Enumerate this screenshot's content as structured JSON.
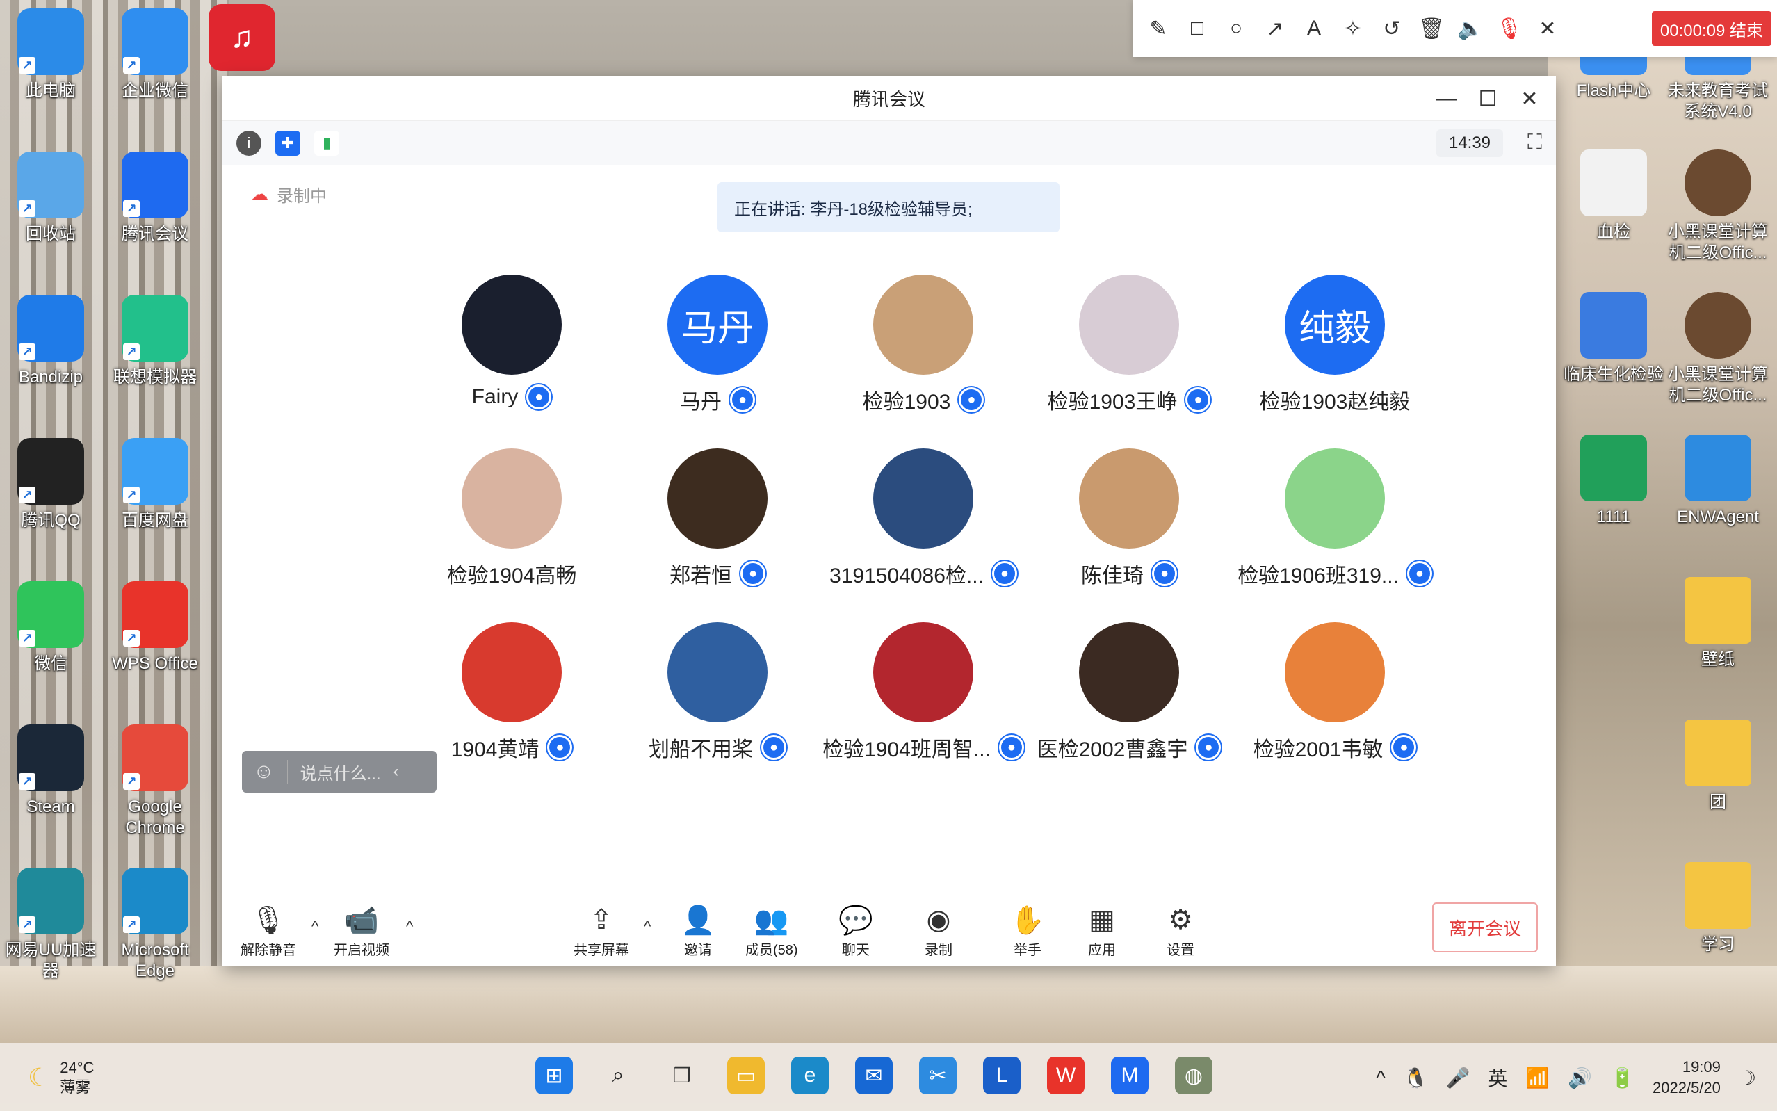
{
  "desktop": {
    "left_icons": [
      {
        "label": "此电脑",
        "icon": "monitor-icon",
        "color": "#2b8be8"
      },
      {
        "label": "企业微信",
        "icon": "wecom-icon",
        "color": "#2f8ef0"
      },
      {
        "label": "回收站",
        "icon": "recycle-bin-icon",
        "color": "#5aa7e8"
      },
      {
        "label": "腾讯会议",
        "icon": "tencent-meeting-icon",
        "color": "#1e6af0"
      },
      {
        "label": "Bandizip",
        "icon": "bandizip-icon",
        "color": "#1f7be8"
      },
      {
        "label": "联想模拟器",
        "icon": "lenovo-emulator-icon",
        "color": "#22c08b"
      },
      {
        "label": "腾讯QQ",
        "icon": "qq-penguin-icon",
        "color": "#222222"
      },
      {
        "label": "百度网盘",
        "icon": "baidu-netdisk-icon",
        "color": "#3aa0f5"
      },
      {
        "label": "微信",
        "icon": "wechat-icon",
        "color": "#2fc45b"
      },
      {
        "label": "WPS Office",
        "icon": "wps-icon",
        "color": "#e8332a"
      },
      {
        "label": "Steam",
        "icon": "steam-icon",
        "color": "#1b2838"
      },
      {
        "label": "Google Chrome",
        "icon": "chrome-icon",
        "color": "#e64a3b"
      },
      {
        "label": "网易UU加速器",
        "icon": "uu-accelerator-icon",
        "color": "#1f8a9a"
      },
      {
        "label": "Microsoft Edge",
        "icon": "edge-icon",
        "color": "#1b8ac9"
      }
    ],
    "top_app_icon": {
      "icon": "netease-music-icon",
      "color": "#e0262f"
    },
    "right_icons": [
      {
        "label": "Flash中心",
        "icon": "flash-icon",
        "color": "#3a8ff0"
      },
      {
        "label": "未来教育考试系统V4.0",
        "icon": "exam-system-icon",
        "color": "#3a8ff0"
      },
      {
        "label": "血检",
        "icon": "document-icon",
        "color": "#f2f2f2"
      },
      {
        "label": "小黑课堂计算机二级Offic...",
        "icon": "avatar-icon",
        "color": "#6b4a30"
      },
      {
        "label": "临床生化检验",
        "icon": "word-doc-icon",
        "color": "#3a7be0"
      },
      {
        "label": "小黑课堂计算机二级Offic...",
        "icon": "avatar-icon",
        "color": "#6b4a30"
      },
      {
        "label": "1111",
        "icon": "spreadsheet-icon",
        "color": "#21a05a"
      },
      {
        "label": "ENWAgent",
        "icon": "enwagent-icon",
        "color": "#2d8be0"
      },
      {
        "label": "壁纸",
        "icon": "folder-icon",
        "color": "#f4c542"
      },
      {
        "label": "团",
        "icon": "folder-icon",
        "color": "#f4c542"
      },
      {
        "label": "学习",
        "icon": "folder-icon",
        "color": "#f4c542"
      }
    ]
  },
  "annotation_toolbar": {
    "tools": [
      "pencil-icon",
      "rectangle-icon",
      "circle-icon",
      "arrow-icon",
      "text-icon",
      "magic-wand-icon",
      "undo-icon",
      "trash-icon",
      "speaker-icon",
      "mic-muted-icon",
      "close-icon"
    ],
    "timer": "00:00:09 结束"
  },
  "meeting": {
    "title": "腾讯会议",
    "time": "14:39",
    "recording_label": "录制中",
    "speaking_label": "正在讲话: 李丹-18级检验辅导员;",
    "participants": [
      {
        "name": "Fairy",
        "avatar_text": "",
        "color": "#1a1f2e"
      },
      {
        "name": "马丹",
        "avatar_text": "马丹",
        "color": "#1d6cf2"
      },
      {
        "name": "检验1903",
        "avatar_text": "",
        "color": "#c9a077"
      },
      {
        "name": "检验1903王峥",
        "avatar_text": "",
        "color": "#d8ccd5"
      },
      {
        "name": "检验1903赵纯毅",
        "avatar_text": "纯毅",
        "color": "#1d6cf2"
      },
      {
        "name": "检验1904高畅",
        "avatar_text": "",
        "color": "#d9b3a0"
      },
      {
        "name": "郑若恒",
        "avatar_text": "",
        "color": "#3d2c1f"
      },
      {
        "name": "3191504086检...",
        "avatar_text": "",
        "color": "#2b4c7e"
      },
      {
        "name": "陈佳琦",
        "avatar_text": "",
        "color": "#c99a6e"
      },
      {
        "name": "检验1906班319...",
        "avatar_text": "",
        "color": "#8bd48a"
      },
      {
        "name": "1904黄靖",
        "avatar_text": "",
        "color": "#d83a2e"
      },
      {
        "name": "划船不用桨",
        "avatar_text": "",
        "color": "#2f5fa0"
      },
      {
        "name": "检验1904班周智...",
        "avatar_text": "",
        "color": "#b3262e"
      },
      {
        "name": "医检2002曹鑫宇",
        "avatar_text": "",
        "color": "#3b2a22"
      },
      {
        "name": "检验2001韦敏",
        "avatar_text": "",
        "color": "#e8813a"
      }
    ],
    "chat_placeholder": "说点什么...",
    "controls": {
      "unmute": "解除静音",
      "video": "开启视频",
      "share": "共享屏幕",
      "invite": "邀请",
      "members": "成员(58)",
      "chat": "聊天",
      "record": "录制",
      "raise_hand": "举手",
      "apps": "应用",
      "settings": "设置",
      "leave": "离开会议"
    }
  },
  "taskbar": {
    "weather_temp": "24°C",
    "weather_desc": "薄雾",
    "apps": [
      {
        "icon": "windows-start-icon",
        "color": "#1e7be8"
      },
      {
        "icon": "search-icon",
        "color": "#222222"
      },
      {
        "icon": "task-view-icon",
        "color": "#333333"
      },
      {
        "icon": "file-explorer-icon",
        "color": "#f0b92e"
      },
      {
        "icon": "edge-icon",
        "color": "#1b8ac9"
      },
      {
        "icon": "mail-icon",
        "color": "#1768d4"
      },
      {
        "icon": "snipping-tool-icon",
        "color": "#2d8be0"
      },
      {
        "icon": "lenovo-vantage-icon",
        "color": "#1a5fc9"
      },
      {
        "icon": "wps-icon",
        "color": "#e8332a"
      },
      {
        "icon": "tencent-meeting-icon",
        "color": "#1e6af0"
      },
      {
        "icon": "app-icon",
        "color": "#7a8a6a"
      }
    ],
    "ime": "英",
    "time": "19:09",
    "date": "2022/5/20"
  }
}
